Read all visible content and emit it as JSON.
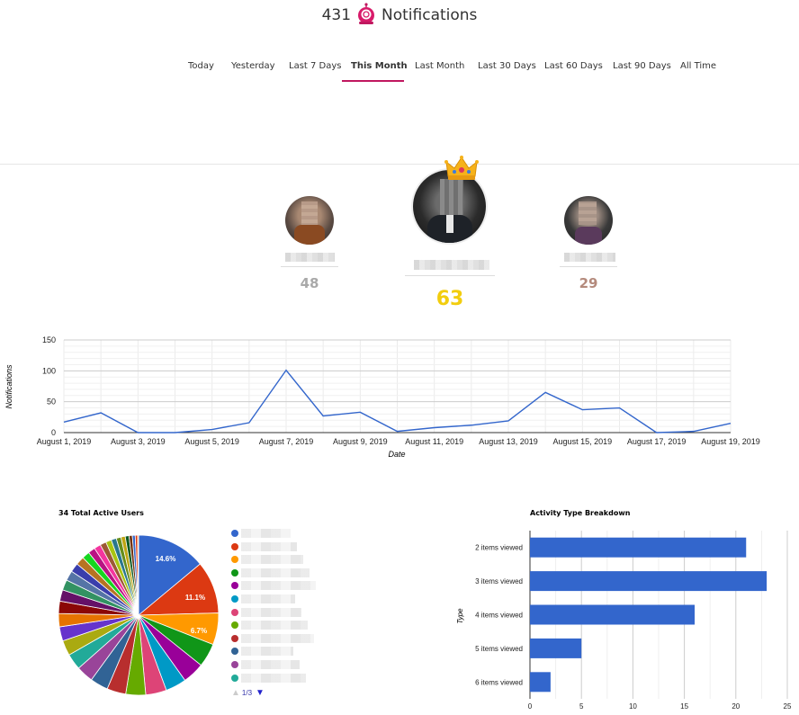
{
  "header": {
    "count": "431",
    "title": "Notifications",
    "mascot_icon": "robot-mascot-icon"
  },
  "tabs": [
    {
      "label": "Today",
      "active": false
    },
    {
      "label": "Yesterday",
      "active": false
    },
    {
      "label": "Last 7 Days",
      "active": false
    },
    {
      "label": "This Month",
      "active": true
    },
    {
      "label": "Last Month",
      "active": false
    },
    {
      "label": "Last 30 Days",
      "active": false
    },
    {
      "label": "Last 60 Days",
      "active": false
    },
    {
      "label": "Last 90 Days",
      "active": false
    },
    {
      "label": "All Time",
      "active": false
    }
  ],
  "leaderboard": {
    "first": {
      "score": "63",
      "color": "#f2cd0e",
      "crown_icon": "crown-icon"
    },
    "second": {
      "score": "48",
      "color": "#a9a9a9"
    },
    "third": {
      "score": "29",
      "color": "#b48a7c"
    }
  },
  "line_chart": {
    "ylabel": "Notifications",
    "xlabel": "Date",
    "yticks": [
      "150",
      "100",
      "50",
      "0"
    ],
    "xtick_labels": [
      "August 1, 2019",
      "August 3, 2019",
      "August 5, 2019",
      "August 7, 2019",
      "August 9, 2019",
      "August 11, 2019",
      "August 13, 2019",
      "August 15, 2019",
      "August 17, 2019",
      "August 19, 2019"
    ],
    "color": "#3366cc"
  },
  "pie_chart": {
    "title": "34 Total Active Users",
    "labels_shown": [
      "14.6%",
      "11.1%",
      "6.7%"
    ],
    "pager": "1/3"
  },
  "bar_chart": {
    "title": "Activity Type Breakdown",
    "ylabel": "Type",
    "xticks": [
      "0",
      "5",
      "10",
      "15",
      "20",
      "25"
    ],
    "color": "#3366cc"
  },
  "chart_data": [
    {
      "type": "line",
      "title": "",
      "xlabel": "Date",
      "ylabel": "Notifications",
      "ylim": [
        0,
        150
      ],
      "x": [
        "August 1, 2019",
        "August 2, 2019",
        "August 3, 2019",
        "August 4, 2019",
        "August 5, 2019",
        "August 6, 2019",
        "August 7, 2019",
        "August 8, 2019",
        "August 9, 2019",
        "August 10, 2019",
        "August 11, 2019",
        "August 12, 2019",
        "August 13, 2019",
        "August 14, 2019",
        "August 15, 2019",
        "August 16, 2019",
        "August 17, 2019",
        "August 18, 2019",
        "August 19, 2019"
      ],
      "series": [
        {
          "values": [
            17,
            32,
            0,
            0,
            5,
            16,
            101,
            27,
            33,
            2,
            8,
            12,
            19,
            65,
            37,
            40,
            0,
            2,
            15
          ]
        }
      ],
      "grid": true
    },
    {
      "type": "pie",
      "title": "34 Total Active Users",
      "values": [
        14.6,
        11.1,
        6.7,
        5.0,
        4.6,
        4.4,
        4.4,
        4.2,
        4.0,
        3.8,
        3.6,
        3.4,
        3.2,
        3.0,
        2.8,
        2.6,
        2.4,
        2.2,
        2.1,
        1.9,
        1.8,
        1.6,
        1.5,
        1.4,
        1.3,
        1.2,
        1.1,
        1.0,
        0.9,
        0.8,
        0.7,
        0.6,
        0.5,
        0.2
      ],
      "colors": [
        "#3366cc",
        "#dc3912",
        "#ff9900",
        "#109618",
        "#990099",
        "#0099c6",
        "#dd4477",
        "#66aa00",
        "#b82e2e",
        "#316395",
        "#994499",
        "#22aa99",
        "#aaaa11",
        "#6633cc",
        "#e67300",
        "#8b0707",
        "#651067",
        "#329262",
        "#5574a6",
        "#3b3eac",
        "#b77322",
        "#16d620",
        "#b91383",
        "#f4359e",
        "#9c5935",
        "#a9c413",
        "#2a778d",
        "#668d1c",
        "#bea413",
        "#0c5922",
        "#743411",
        "#3366cc",
        "#dc3912",
        "#ff9900"
      ],
      "legend": "right"
    },
    {
      "type": "bar",
      "orientation": "horizontal",
      "title": "Activity Type Breakdown",
      "ylabel": "Type",
      "categories": [
        "2 items viewed",
        "3 items viewed",
        "4 items viewed",
        "5 items viewed",
        "6 items viewed"
      ],
      "values": [
        21,
        23,
        16,
        5,
        2
      ],
      "xlim": [
        0,
        25
      ],
      "grid": true
    }
  ]
}
